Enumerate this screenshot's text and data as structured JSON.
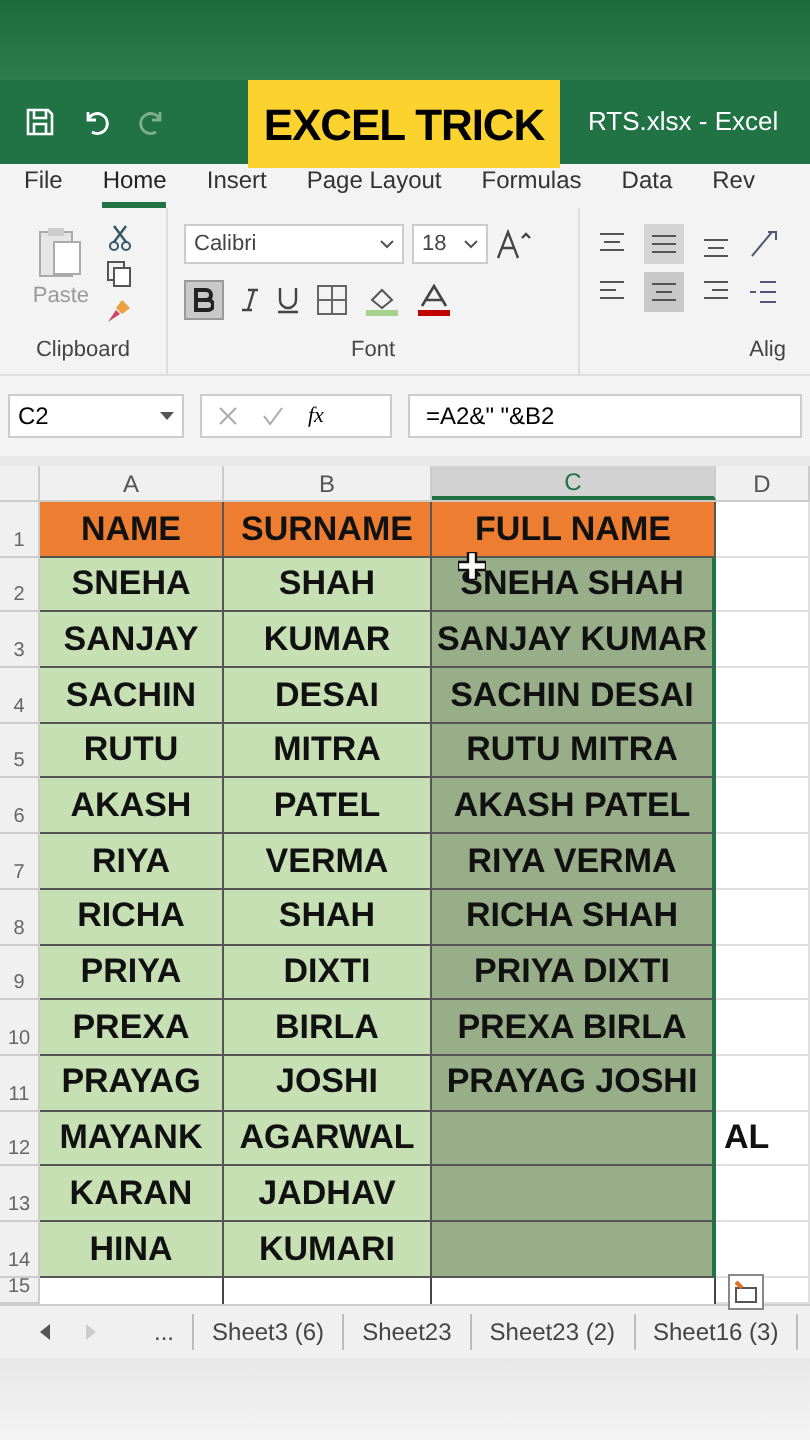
{
  "title_bar": {
    "title": "RTS.xlsx  -  Excel"
  },
  "overlay": {
    "text": "EXCEL TRICK"
  },
  "menu_tabs": [
    {
      "label": "File",
      "selected": false
    },
    {
      "label": "Home",
      "selected": true
    },
    {
      "label": "Insert",
      "selected": false
    },
    {
      "label": "Page Layout",
      "selected": false
    },
    {
      "label": "Formulas",
      "selected": false
    },
    {
      "label": "Data",
      "selected": false
    },
    {
      "label": "Rev",
      "selected": false
    }
  ],
  "ribbon": {
    "paste_label": "Paste",
    "clipboard_label": "Clipboard",
    "font_name": "Calibri",
    "font_size": "18",
    "font_label": "Font",
    "alignment_label": "Alig",
    "bold": true,
    "center_aligned": true
  },
  "formula_bar": {
    "name_box": "C2",
    "fx": "fx",
    "formula": "=A2&\" \"&B2"
  },
  "columns": [
    {
      "label": "A",
      "selected": false
    },
    {
      "label": "B",
      "selected": false
    },
    {
      "label": "C",
      "selected": true
    },
    {
      "label": "D",
      "selected": false
    }
  ],
  "rows": [
    {
      "number": "1",
      "kind": "header",
      "a": "NAME",
      "b": "SURNAME",
      "c": "FULL NAME",
      "c_selected": false
    },
    {
      "number": "2",
      "kind": "data",
      "a": "SNEHA",
      "b": "SHAH",
      "c": "SNEHA SHAH",
      "c_selected": true
    },
    {
      "number": "3",
      "kind": "data",
      "a": "SANJAY",
      "b": "KUMAR",
      "c": "SANJAY KUMAR",
      "c_selected": true
    },
    {
      "number": "4",
      "kind": "data",
      "a": "SACHIN",
      "b": "DESAI",
      "c": "SACHIN DESAI",
      "c_selected": true
    },
    {
      "number": "5",
      "kind": "data",
      "a": "RUTU",
      "b": "MITRA",
      "c": "RUTU MITRA",
      "c_selected": true
    },
    {
      "number": "6",
      "kind": "data",
      "a": "AKASH",
      "b": "PATEL",
      "c": "AKASH PATEL",
      "c_selected": true
    },
    {
      "number": "7",
      "kind": "data",
      "a": "RIYA",
      "b": "VERMA",
      "c": "RIYA VERMA",
      "c_selected": true
    },
    {
      "number": "8",
      "kind": "data",
      "a": "RICHA",
      "b": "SHAH",
      "c": "RICHA SHAH",
      "c_selected": true
    },
    {
      "number": "9",
      "kind": "data",
      "a": "PRIYA",
      "b": "DIXTI",
      "c": "PRIYA DIXTI",
      "c_selected": true
    },
    {
      "number": "10",
      "kind": "data",
      "a": "PREXA",
      "b": "BIRLA",
      "c": "PREXA BIRLA",
      "c_selected": true
    },
    {
      "number": "11",
      "kind": "data",
      "a": "PRAYAG",
      "b": "JOSHI",
      "c": "PRAYAG JOSHI",
      "c_selected": true
    },
    {
      "number": "12",
      "kind": "data",
      "a": "MAYANK",
      "b": "AGARWAL",
      "c_selected": true,
      "d": "AL"
    },
    {
      "number": "13",
      "kind": "data",
      "a": "KARAN",
      "b": "JADHAV",
      "c_selected": true
    },
    {
      "number": "14",
      "kind": "data",
      "a": "HINA",
      "b": "KUMARI",
      "c_selected": true
    },
    {
      "number": "15",
      "kind": "blank",
      "c_selected": false
    }
  ],
  "sheet_tabs": [
    {
      "label": "...",
      "selected": false
    },
    {
      "label": "Sheet3 (6)",
      "selected": false
    },
    {
      "label": "Sheet23",
      "selected": false
    },
    {
      "label": "Sheet23 (2)",
      "selected": false
    },
    {
      "label": "Sheet16 (3)",
      "selected": false
    }
  ]
}
